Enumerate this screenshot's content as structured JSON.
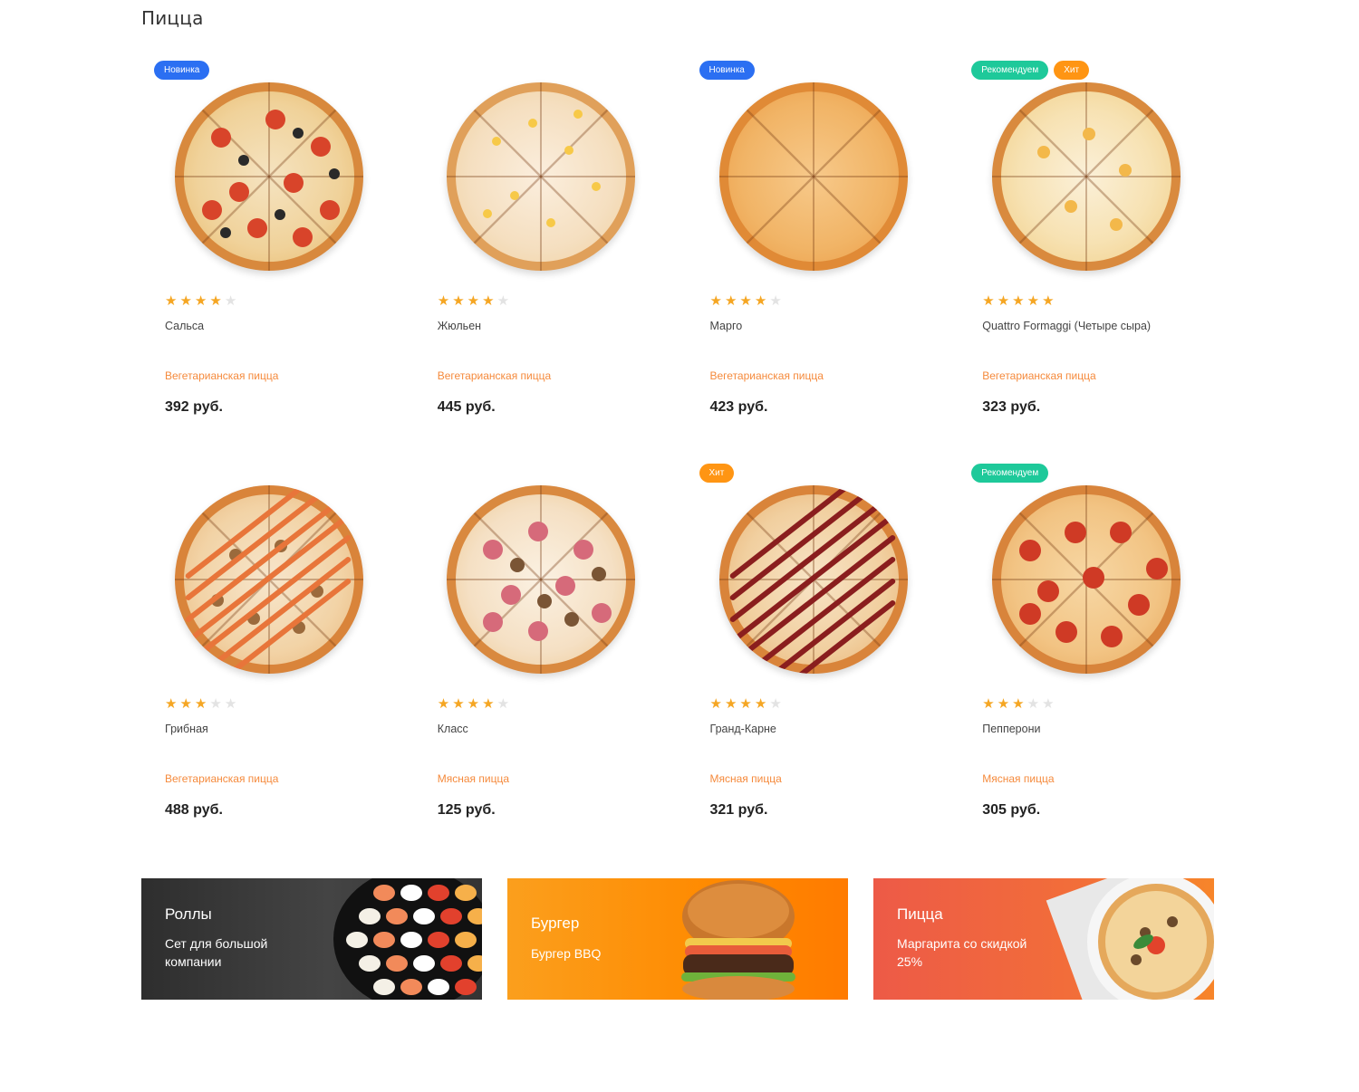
{
  "section": {
    "title": "Пицца"
  },
  "colors": {
    "badge_new": "#2b6ff2",
    "badge_recommend": "#1ec99a",
    "badge_hit": "#ff9513",
    "star_on": "#f5a623",
    "star_off": "#e3e3e3",
    "category": "#f58a3c"
  },
  "products": [
    {
      "name": "Сальса",
      "category": "Вегетарианская пицца",
      "price": "392 руб.",
      "rating": 4,
      "badges": [
        "Новинка"
      ],
      "badge_types": [
        "new"
      ]
    },
    {
      "name": "Жюльен",
      "category": "Вегетарианская пицца",
      "price": "445 руб.",
      "rating": 4,
      "badges": [],
      "badge_types": []
    },
    {
      "name": "Марго",
      "category": "Вегетарианская пицца",
      "price": "423 руб.",
      "rating": 4,
      "badges": [
        "Новинка"
      ],
      "badge_types": [
        "new"
      ]
    },
    {
      "name": "Quattro Formaggi (Четыре сыра)",
      "category": "Вегетарианская пицца",
      "price": "323 руб.",
      "rating": 5,
      "badges": [
        "Рекомендуем",
        "Хит"
      ],
      "badge_types": [
        "recommend",
        "hit"
      ]
    },
    {
      "name": "Грибная",
      "category": "Вегетарианская пицца",
      "price": "488 руб.",
      "rating": 3,
      "badges": [],
      "badge_types": []
    },
    {
      "name": "Класс",
      "category": "Мясная пицца",
      "price": "125 руб.",
      "rating": 4,
      "badges": [],
      "badge_types": []
    },
    {
      "name": "Гранд-Карне",
      "category": "Мясная пицца",
      "price": "321 руб.",
      "rating": 4,
      "badges": [
        "Хит"
      ],
      "badge_types": [
        "hit"
      ]
    },
    {
      "name": "Пепперони",
      "category": "Мясная пицца",
      "price": "305 руб.",
      "rating": 3,
      "badges": [
        "Рекомендуем"
      ],
      "badge_types": [
        "recommend"
      ]
    }
  ],
  "banners": [
    {
      "title": "Роллы",
      "subtitle": "Сет для большой компании",
      "image": "sushi-set-image"
    },
    {
      "title": "Бургер",
      "subtitle": "Бургер BBQ",
      "image": "burger-image"
    },
    {
      "title": "Пицца",
      "subtitle": "Маргарита со скидкой 25%",
      "image": "pizza-image"
    }
  ]
}
